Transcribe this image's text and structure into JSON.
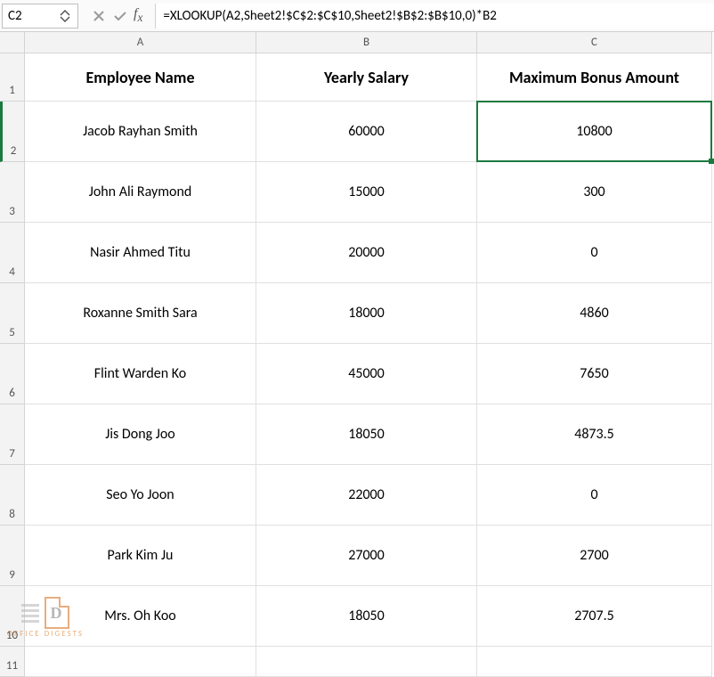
{
  "namebox": "C2",
  "formula": "=XLOOKUP(A2,Sheet2!$C$2:$C$10,Sheet2!$B$2:$B$10,0)*B2",
  "columns": [
    "A",
    "B",
    "C"
  ],
  "headers": [
    "Employee Name",
    "Yearly Salary",
    "Maximum Bonus Amount"
  ],
  "rows": [
    {
      "n": "1"
    },
    {
      "n": "2",
      "a": "Jacob Rayhan Smith",
      "b": "60000",
      "c": "10800"
    },
    {
      "n": "3",
      "a": "John Ali Raymond",
      "b": "15000",
      "c": "300"
    },
    {
      "n": "4",
      "a": "Nasir Ahmed Titu",
      "b": "20000",
      "c": "0"
    },
    {
      "n": "5",
      "a": "Roxanne Smith Sara",
      "b": "18000",
      "c": "4860"
    },
    {
      "n": "6",
      "a": "Flint Warden Ko",
      "b": "45000",
      "c": "7650"
    },
    {
      "n": "7",
      "a": "Jis Dong Joo",
      "b": "18050",
      "c": "4873.5"
    },
    {
      "n": "8",
      "a": "Seo Yo Joon",
      "b": "22000",
      "c": "0"
    },
    {
      "n": "9",
      "a": "Park Kim Ju",
      "b": "27000",
      "c": "2700"
    },
    {
      "n": "10",
      "a": "Mrs. Oh Koo",
      "b": "18050",
      "c": "2707.5"
    },
    {
      "n": "11"
    }
  ],
  "watermark": "OFFICE DIGESTS",
  "selected_cell": "C2"
}
